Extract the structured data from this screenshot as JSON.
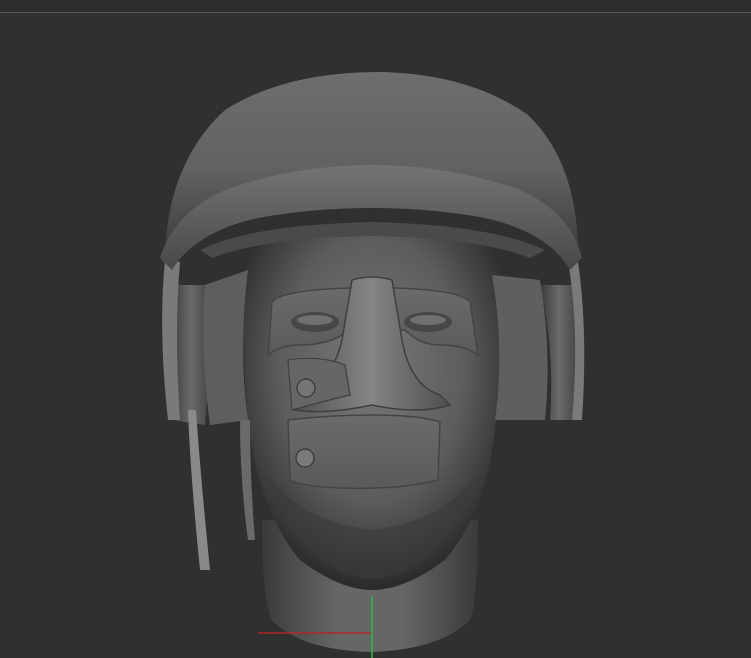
{
  "viewport": {
    "background": "#303030",
    "axis_colors": {
      "x": "#b02828",
      "y": "#2fb84a"
    }
  },
  "model": {
    "description_icon": "sculpt-mesh-head-helmet"
  }
}
